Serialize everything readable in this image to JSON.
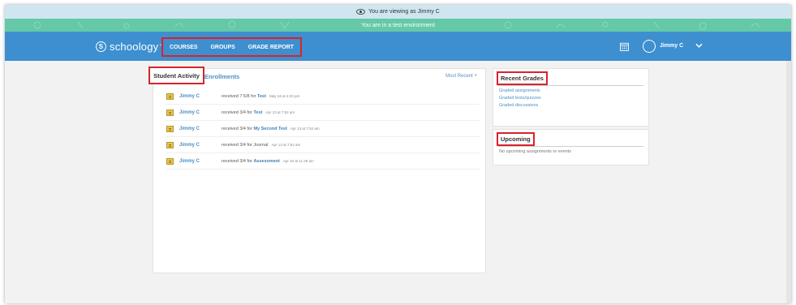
{
  "banner": {
    "viewing_as": "You are viewing as Jimmy C",
    "test_env": "You are in a test environment"
  },
  "nav": {
    "logo_text": "schoology",
    "links": [
      "COURSES",
      "GROUPS",
      "GRADE REPORT"
    ],
    "user_name": "Jimmy C"
  },
  "activity": {
    "tab_active": "Student Activity",
    "tab_other": "Enrollments",
    "sort_label": "Most Recent ˅",
    "items": [
      {
        "who": "Jimmy C",
        "pre": "received 7.5/8 for ",
        "item": "Test",
        "post": "",
        "time": "May 24 at 4:23 pm"
      },
      {
        "who": "Jimmy C",
        "pre": "received 3/4 for ",
        "item": "Test",
        "post": "",
        "time": "Apr 13 at 7:52 am"
      },
      {
        "who": "Jimmy C",
        "pre": "received 3/4 for ",
        "item": "My Second Test",
        "post": "",
        "time": "Apr 13 at 7:52 am"
      },
      {
        "who": "Jimmy C",
        "pre": "received 3/4 for Journal",
        "item": "",
        "post": "",
        "time": "Apr 13 at 7:52 am"
      },
      {
        "who": "Jimmy C",
        "pre": "received 3/4 for ",
        "item": "Assessment",
        "post": "",
        "time": "Apr 10 at 11:49 am"
      }
    ]
  },
  "recent_grades": {
    "title": "Recent Grades",
    "links": [
      "Graded assignments",
      "Graded tests/quizzes",
      "Graded discussions"
    ]
  },
  "upcoming": {
    "title": "Upcoming",
    "empty_text": "No upcoming assignments or events"
  },
  "colors": {
    "nav_blue": "#3d8fcf",
    "test_green": "#65c9a8",
    "highlight_red": "#d9232b",
    "link_blue": "#4a90c8"
  }
}
